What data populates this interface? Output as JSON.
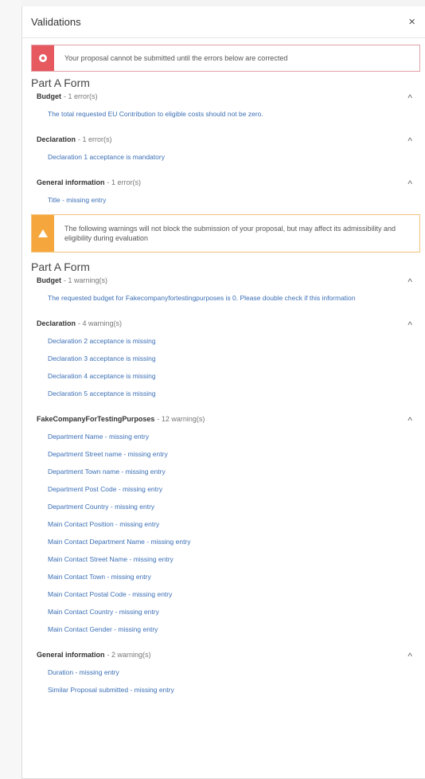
{
  "header": {
    "title": "Validations",
    "close_glyph": "×"
  },
  "error_banner": {
    "icon": "error-circle-icon",
    "text": "Your proposal cannot be submitted until the errors below are corrected",
    "color": "#e5595f"
  },
  "warning_banner": {
    "icon": "warning-triangle-icon",
    "text": "The following warnings will not block the submission of your proposal, but may affect its admissibility and eligibility during evaluation",
    "color": "#f5a73d"
  },
  "errors": {
    "part_title": "Part A Form",
    "groups": [
      {
        "name": "Budget",
        "count": "- 1 error(s)",
        "items": [
          "The total requested EU Contribution to eligible costs should not be zero."
        ]
      },
      {
        "name": "Declaration",
        "count": "- 1 error(s)",
        "items": [
          "Declaration 1 acceptance is mandatory"
        ]
      },
      {
        "name": "General information",
        "count": "- 1 error(s)",
        "items": [
          "Title - missing entry"
        ]
      }
    ]
  },
  "warnings": {
    "part_title": "Part A Form",
    "groups": [
      {
        "name": "Budget",
        "count": "- 1 warning(s)",
        "items": [
          "The requested budget for Fakecompanyfortestingpurposes is 0. Please double check if this information"
        ]
      },
      {
        "name": "Declaration",
        "count": "- 4 warning(s)",
        "items": [
          "Declaration 2 acceptance is missing",
          "Declaration 3 acceptance is missing",
          "Declaration 4 acceptance is missing",
          "Declaration 5 acceptance is missing"
        ]
      },
      {
        "name": "FakeCompanyForTestingPurposes",
        "count": "- 12 warning(s)",
        "items": [
          "Department Name - missing entry",
          "Department Street name - missing entry",
          "Department Town name - missing entry",
          "Department Post Code - missing entry",
          "Department Country - missing entry",
          "Main Contact Position - missing entry",
          "Main Contact Department Name - missing entry",
          "Main Contact Street Name - missing entry",
          "Main Contact Town - missing entry",
          "Main Contact Postal Code - missing entry",
          "Main Contact Country - missing entry",
          "Main Contact Gender - missing entry"
        ]
      },
      {
        "name": "General information",
        "count": "- 2 warning(s)",
        "items": [
          "Duration - missing entry",
          "Similar Proposal submitted - missing entry"
        ]
      }
    ]
  },
  "chevron_glyph": "^"
}
